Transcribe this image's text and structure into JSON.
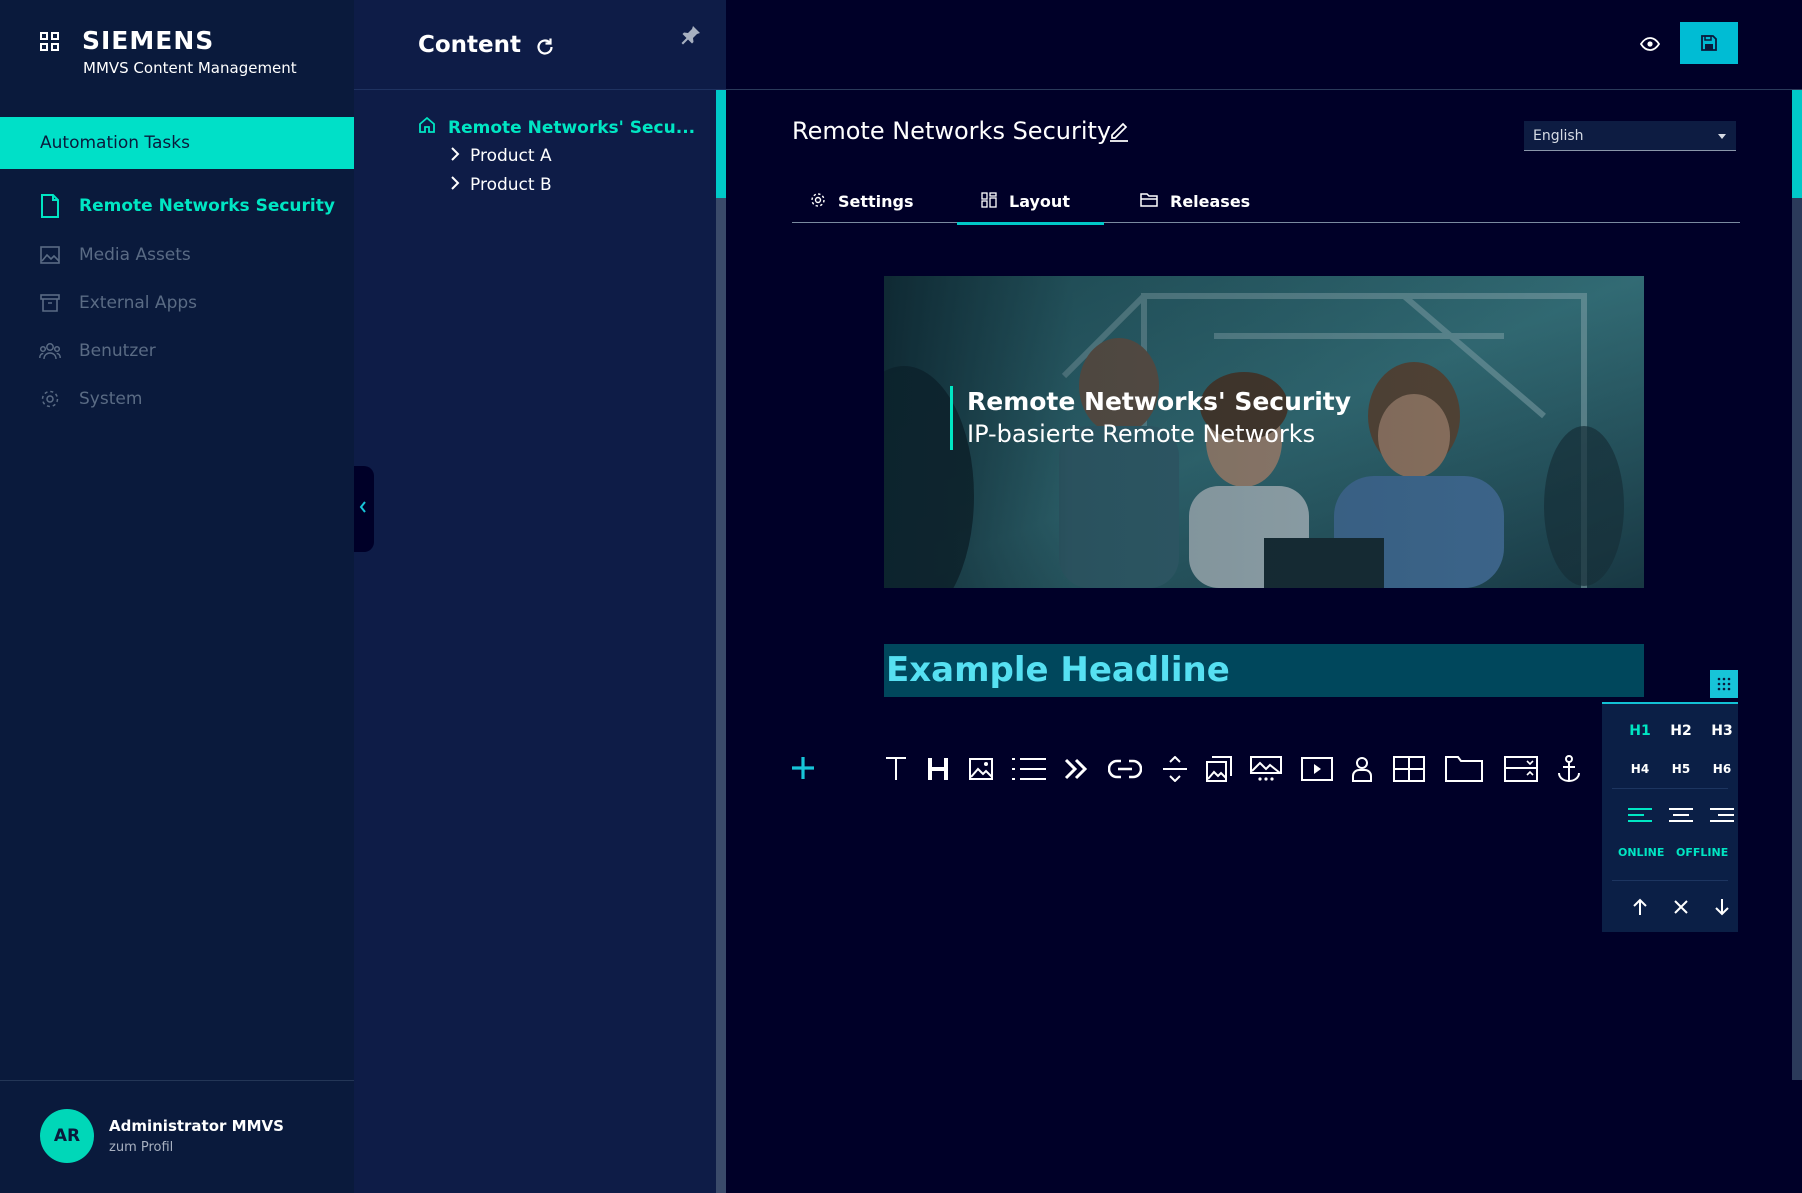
{
  "brand": {
    "name": "SIEMENS",
    "subtitle": "MMVS Content Management"
  },
  "sidebar": {
    "automation_label": "Automation Tasks",
    "items": [
      {
        "label": "Remote Networks Security",
        "icon": "document-icon",
        "active": true
      },
      {
        "label": "Media Assets",
        "icon": "image-icon",
        "active": false
      },
      {
        "label": "External Apps",
        "icon": "archive-icon",
        "active": false
      },
      {
        "label": "Benutzer",
        "icon": "users-icon",
        "active": false
      },
      {
        "label": "System",
        "icon": "gear-icon",
        "active": false
      }
    ]
  },
  "profile": {
    "initials": "AR",
    "name": "Administrator MMVS",
    "link": "zum Profil"
  },
  "tree": {
    "title": "Content",
    "root": "Remote Networks' Secu...",
    "children": [
      "Product A",
      "Product B"
    ]
  },
  "editor": {
    "page_title": "Remote Networks Security",
    "language": "English",
    "tabs": [
      {
        "label": "Settings",
        "icon": "gear-icon",
        "active": false
      },
      {
        "label": "Layout",
        "icon": "layout-icon",
        "active": true
      },
      {
        "label": "Releases",
        "icon": "folder-icon",
        "active": false
      }
    ],
    "hero": {
      "title": "Remote Networks' Security",
      "subtitle": "IP-basierte Remote Networks"
    },
    "headline": "Example Headline",
    "toolbar_icons": [
      "text-icon",
      "heading-icon",
      "image-icon",
      "list-icon",
      "quote-icon",
      "link-icon",
      "divider-icon",
      "gallery-icon",
      "carousel-icon",
      "video-icon",
      "person-icon",
      "table-icon",
      "folder-icon",
      "accordion-icon",
      "anchor-icon"
    ]
  },
  "heading_panel": {
    "levels": [
      "H1",
      "H2",
      "H3",
      "H4",
      "H5",
      "H6"
    ],
    "selected_level": "H1",
    "alignments": [
      "align-left-icon",
      "align-center-icon",
      "align-right-icon"
    ],
    "states": [
      "ONLINE",
      "OFFLINE"
    ]
  },
  "colors": {
    "accent": "#00e6c3",
    "sidebar_bg": "#0a1a3c",
    "tree_bg": "#0e1c47",
    "main_bg": "#000028",
    "primary_button": "#00bcd4",
    "headline_bg": "#00475c",
    "headline_text": "#56e0f2"
  }
}
